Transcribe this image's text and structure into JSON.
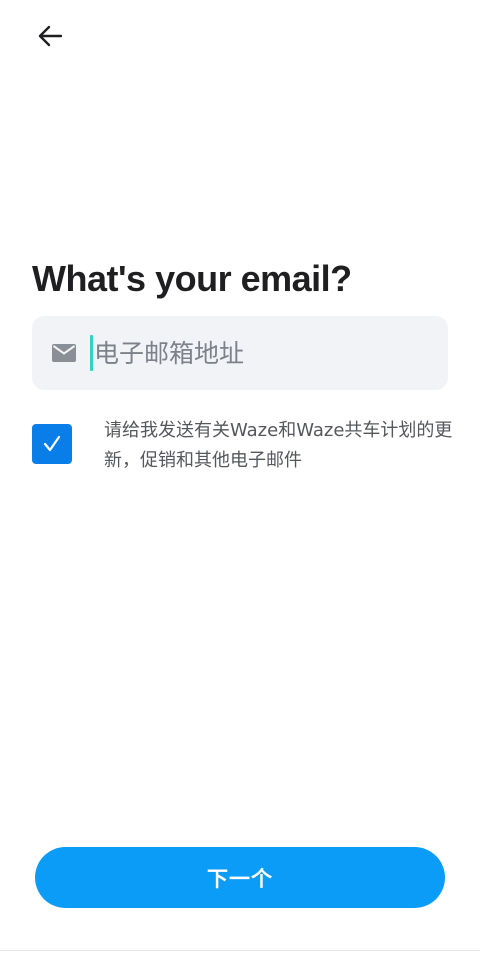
{
  "header": {
    "back_icon": "arrow-left-icon"
  },
  "title": "What's your email?",
  "email_field": {
    "placeholder": "电子邮箱地址",
    "value": "",
    "icon": "mail-icon",
    "caret_color": "#2ed3c2"
  },
  "consent": {
    "checked": true,
    "text": "请给我发送有关Waze和Waze共车计划的更新，促销和其他电子邮件"
  },
  "next_button": {
    "label": "下一个"
  },
  "colors": {
    "primary": "#0a9cf7",
    "checkbox": "#0a7ee8",
    "field_background": "#f2f3f6",
    "title_text": "#1f1f22"
  }
}
